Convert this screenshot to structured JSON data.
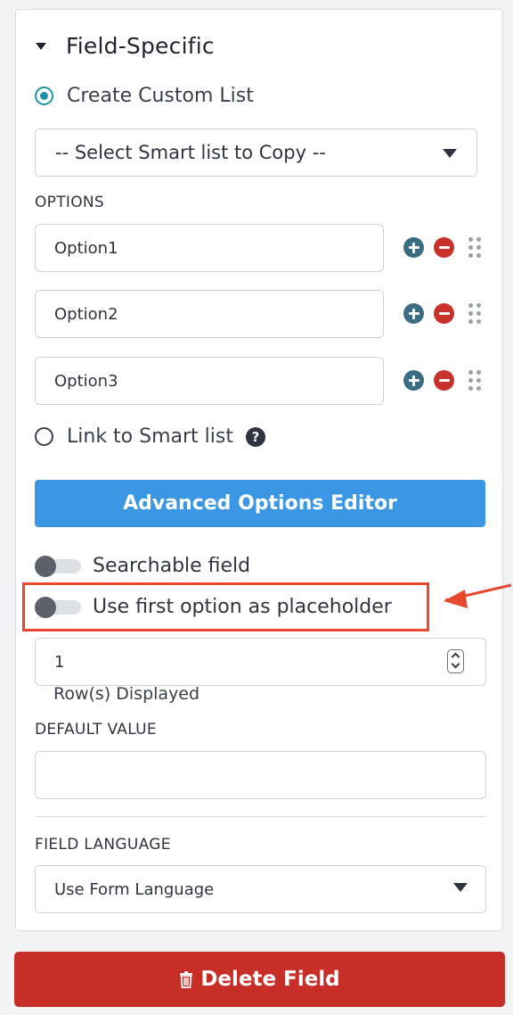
{
  "section": {
    "title": "Field-Specific"
  },
  "list_source": {
    "custom_label": "Create Custom List",
    "smart_select_value": "-- Select Smart list to Copy --",
    "smart_label": "Link to Smart list"
  },
  "options": {
    "label": "OPTIONS",
    "items": [
      "Option1",
      "Option2",
      "Option3"
    ]
  },
  "advanced_button": "Advanced Options Editor",
  "toggles": {
    "searchable": "Searchable field",
    "placeholder": "Use first option as placeholder"
  },
  "rows": {
    "value": "1",
    "hint": "Row(s) Displayed"
  },
  "default_value": {
    "label": "DEFAULT VALUE",
    "value": ""
  },
  "language": {
    "label": "FIELD LANGUAGE",
    "value": "Use Form Language"
  },
  "delete_button": "Delete Field",
  "colors": {
    "accent": "#1e93a8",
    "primary_button": "#3b97e4",
    "danger": "#c72e28",
    "annotation": "#e5492f"
  },
  "icons": [
    "caret-down-icon",
    "help-icon",
    "add-icon",
    "remove-icon",
    "drag-handle-icon",
    "trash-icon"
  ]
}
